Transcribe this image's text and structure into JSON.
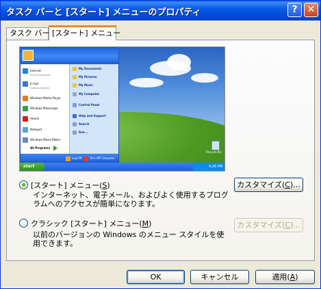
{
  "window": {
    "title": "タスク バーと [スタート] メニューのプロパティ",
    "help_label": "?",
    "close_label": "✕"
  },
  "tabs": [
    {
      "label": "タスク バー",
      "active": false
    },
    {
      "label": "[スタート] メニュー",
      "active": true
    }
  ],
  "preview": {
    "start_menu": {
      "left_items": [
        {
          "label": "Internet",
          "sub": "Internet Explorer",
          "icon": "internet-explorer-icon",
          "color": "#2f7bd8"
        },
        {
          "label": "E-mail",
          "sub": "Outlook Express",
          "icon": "email-icon",
          "color": "#3a79c8"
        },
        {
          "label": "Windows Media Player",
          "icon": "media-player-icon",
          "color": "#e07a1a"
        },
        {
          "label": "Windows Messenger",
          "icon": "messenger-icon",
          "color": "#3aa04a"
        },
        {
          "label": "Hearts",
          "icon": "hearts-icon",
          "color": "#d02020"
        },
        {
          "label": "Notepad",
          "icon": "notepad-icon",
          "color": "#5ea0d0"
        },
        {
          "label": "Windows Movie Maker",
          "icon": "movie-maker-icon",
          "color": "#6a8ac0"
        }
      ],
      "all_programs": "All Programs",
      "right_items": [
        {
          "label": "My Documents",
          "icon": "documents-folder-icon",
          "color": "#f0c040"
        },
        {
          "label": "My Pictures",
          "icon": "pictures-folder-icon",
          "color": "#f0c040"
        },
        {
          "label": "My Music",
          "icon": "music-folder-icon",
          "color": "#f0c040"
        },
        {
          "label": "My Computer",
          "icon": "computer-icon",
          "color": "#8fa6c8"
        },
        {
          "label": "Control Panel",
          "icon": "control-panel-icon",
          "color": "#7aa0d8"
        },
        {
          "label": "Help and Support",
          "icon": "help-icon",
          "color": "#3a70c8"
        },
        {
          "label": "Search",
          "icon": "search-icon",
          "color": "#8aa0c0"
        },
        {
          "label": "Run...",
          "icon": "run-icon",
          "color": "#8aa0c0"
        }
      ],
      "log_off": "Log Off",
      "turn_off": "Turn Off Computer"
    },
    "taskbar": {
      "start_label": "start",
      "clock": "4:26 PM",
      "recycle_bin": "Recycle Bin"
    }
  },
  "options": {
    "start_menu": {
      "label_prefix": "[スタート] メニュー(",
      "hotkey": "S",
      "label_suffix": ")",
      "selected": true,
      "description": "インターネット、電子メール、およびよく使用するプログラムへのアクセスが簡単になります。",
      "customize_prefix": "カスタマイズ(",
      "customize_hotkey": "C",
      "customize_suffix": ")...",
      "customize_enabled": true
    },
    "classic": {
      "label_prefix": "クラシック [スタート] メニュー(",
      "hotkey": "M",
      "label_suffix": ")",
      "selected": false,
      "description": "以前のバージョンの Windows のメニュー スタイルを使用できます。",
      "customize_prefix": "カスタマイズ(",
      "customize_hotkey": "C",
      "customize_suffix": ")...",
      "customize_enabled": false
    }
  },
  "buttons": {
    "ok": "OK",
    "cancel": "キャンセル",
    "apply_prefix": "適用(",
    "apply_hotkey": "A",
    "apply_suffix": ")"
  }
}
